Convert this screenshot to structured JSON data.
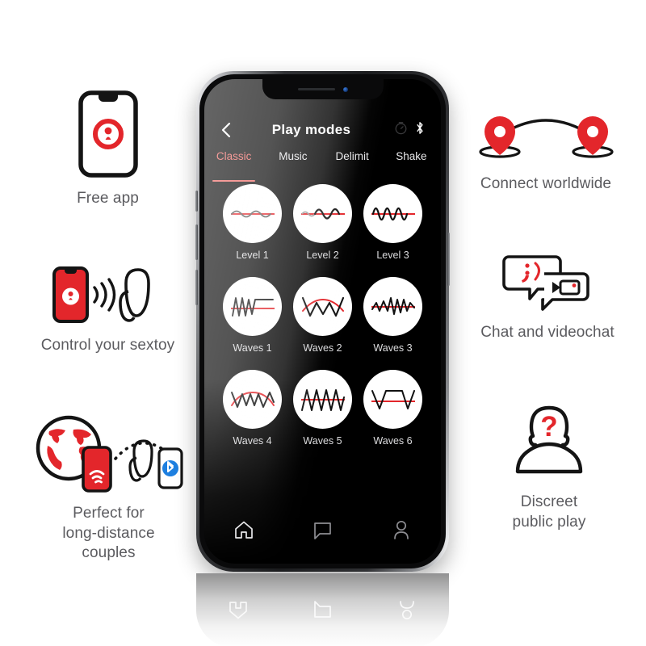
{
  "theme": {
    "brand_red": "#E3262B",
    "accent_coral": "#F0635F",
    "screen_black": "#000000",
    "caption_gray": "#5B5B5F"
  },
  "features_left": [
    {
      "id": "free-app",
      "icon": "phone-with-lock-logo-icon",
      "caption": "Free app"
    },
    {
      "id": "control-sextoy",
      "icon": "phone-signal-toy-icon",
      "caption": "Control your sextoy"
    },
    {
      "id": "long-distance",
      "icon": "globe-phone-bluetooth-toy-icon",
      "caption": "Perfect for\nlong-distance\ncouples"
    }
  ],
  "features_right": [
    {
      "id": "connect-worldwide",
      "icon": "two-map-pins-arc-icon",
      "caption": "Connect worldwide"
    },
    {
      "id": "chat-videochat",
      "icon": "speech-bubbles-camera-icon",
      "caption": "Chat and videochat"
    },
    {
      "id": "discreet-play",
      "icon": "anonymous-person-question-icon",
      "caption": "Discreet\npublic play"
    }
  ],
  "phone": {
    "header": {
      "back_icon": "chevron-left-icon",
      "title": "Play modes",
      "right_icons": [
        "timer-dial-icon",
        "bluetooth-icon"
      ]
    },
    "tabs": [
      {
        "label": "Classic",
        "active": true
      },
      {
        "label": "Music",
        "active": false
      },
      {
        "label": "Delimit",
        "active": false
      },
      {
        "label": "Shake",
        "active": false
      }
    ],
    "modes": [
      {
        "label": "Level 1",
        "wave": "sine-low"
      },
      {
        "label": "Level 2",
        "wave": "sine-growing"
      },
      {
        "label": "Level 3",
        "wave": "sine-tall"
      },
      {
        "label": "Waves 1",
        "wave": "zigzag-plateau"
      },
      {
        "label": "Waves 2",
        "wave": "vee-arc"
      },
      {
        "label": "Waves 3",
        "wave": "zigzag-mixed"
      },
      {
        "label": "Waves 4",
        "wave": "zigzag-arc"
      },
      {
        "label": "Waves 5",
        "wave": "sawtooth"
      },
      {
        "label": "Waves 6",
        "wave": "trapezoid"
      }
    ],
    "navbar": [
      {
        "id": "home",
        "icon": "home-icon"
      },
      {
        "id": "chat",
        "icon": "chat-bubble-icon"
      },
      {
        "id": "profile",
        "icon": "person-icon"
      }
    ]
  }
}
